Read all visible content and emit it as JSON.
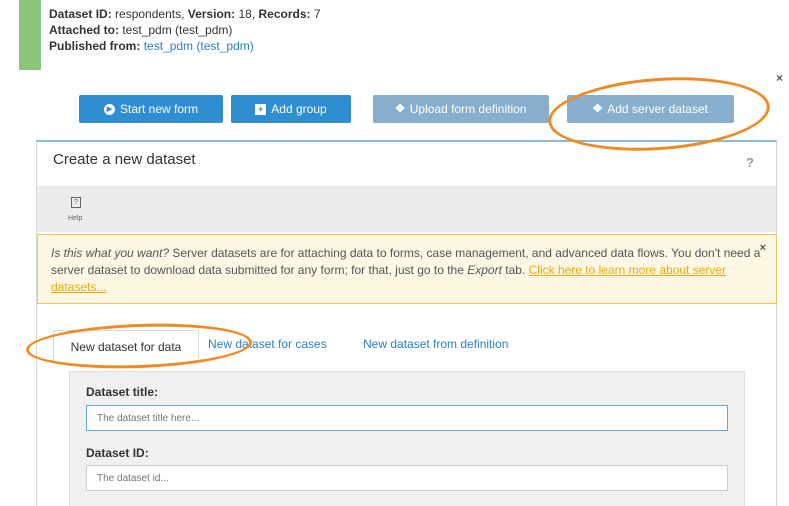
{
  "info": {
    "id_label": "Dataset ID:",
    "id_value": "respondents",
    "version_label": "Version:",
    "version_value": "18",
    "records_label": "Records:",
    "records_value": "7",
    "attached_label": "Attached to:",
    "attached_value": "test_pdm (test_pdm)",
    "published_label": "Published from:",
    "published_value": "test_pdm (test_pdm)"
  },
  "close_glyph": "×",
  "toolbar": {
    "start_form": "Start new form",
    "add_group": "Add group",
    "upload_def": "Upload form definition",
    "add_dataset": "Add server dataset"
  },
  "panel": {
    "title": "Create a new dataset",
    "help_mark": "?",
    "help_label": "Help",
    "notice_lead": "Is this what you want?",
    "notice_body": " Server datasets are for attaching data to forms, case management, and advanced data flows. You don't need a server dataset to download data submitted for any form; for that, just go to the ",
    "notice_export": "Export",
    "notice_tail": " tab. ",
    "notice_link": "Click here to learn more about server datasets...",
    "notice_close": "×"
  },
  "tabs": [
    {
      "label": "New dataset for data"
    },
    {
      "label": "New dataset for cases"
    },
    {
      "label": "New dataset from definition"
    }
  ],
  "form": {
    "title_label": "Dataset title:",
    "title_placeholder": "The dataset title here...",
    "id_label": "Dataset ID:",
    "id_placeholder": "The dataset id..."
  },
  "colors": {
    "accent_green": "#8cc47a",
    "primary_blue": "#2f8ed0",
    "muted_blue": "#87aecd",
    "annotation_orange": "#f08a24",
    "warning_bg": "#fcf8e3"
  }
}
